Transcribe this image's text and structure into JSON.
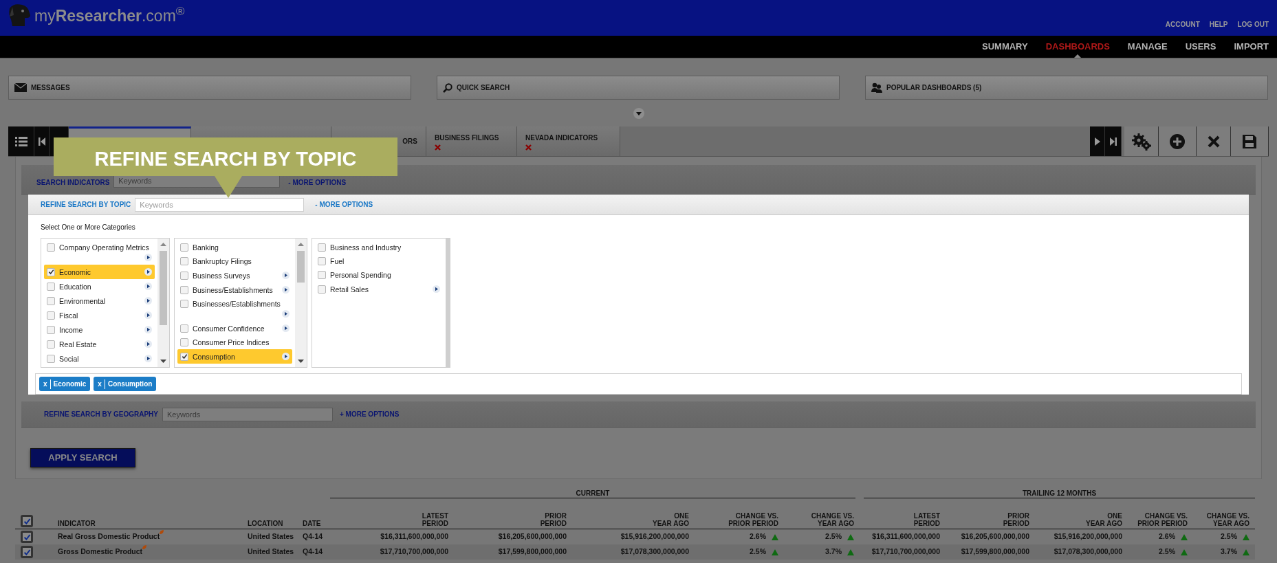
{
  "header": {
    "logo": "my**Researcher**.com$^{®}$",
    "account_links": [
      "ACCOUNT",
      "HELP",
      "LOG OUT"
    ]
  },
  "nav": [
    {
      "label": "SUMMARY",
      "selected": false
    },
    {
      "label": "DASHBOARDS",
      "selected": true
    },
    {
      "label": "MANAGE",
      "selected": false
    },
    {
      "label": "USERS",
      "selected": false
    },
    {
      "label": "IMPORT",
      "selected": false
    }
  ],
  "quick_panels": [
    {
      "label": "MESSAGES",
      "kind": "messages"
    },
    {
      "label": "QUICK SEARCH",
      "kind": "search"
    },
    {
      "label": "POPULAR DASHBOARDS (5)",
      "kind": "people"
    }
  ],
  "tabs": [
    {
      "selected": true
    },
    {
      "selected": false
    },
    {
      "label": "ORS",
      "selected": false
    },
    {
      "label": "BUSINESS FILINGS",
      "closable": true,
      "selected": false
    },
    {
      "label": "NEVADA INDICATORS",
      "closable": true,
      "selected": false
    }
  ],
  "callout": {
    "text": "REFINE SEARCH BY TOPIC"
  },
  "search_indicators": {
    "label": "SEARCH INDICATORS",
    "placeholder": "Keywords",
    "more_options": "- MORE OPTIONS"
  },
  "topic": {
    "label": "REFINE SEARCH BY TOPIC",
    "placeholder": "Keywords",
    "more_options": "- MORE OPTIONS",
    "instructions": "Select One or More Categories",
    "columns": [
      [
        {
          "label": "Company Operating Metrics",
          "checked": false,
          "selected": false,
          "expandable": true
        },
        {
          "label": "Economic",
          "checked": true,
          "selected": true,
          "expandable": true
        },
        {
          "label": "Education",
          "checked": false,
          "selected": false,
          "expandable": true
        },
        {
          "label": "Environmental",
          "checked": false,
          "selected": false,
          "expandable": true
        },
        {
          "label": "Fiscal",
          "checked": false,
          "selected": false,
          "expandable": true
        },
        {
          "label": "Income",
          "checked": false,
          "selected": false,
          "expandable": true
        },
        {
          "label": "Real Estate",
          "checked": false,
          "selected": false,
          "expandable": true
        },
        {
          "label": "Social",
          "checked": false,
          "selected": false,
          "expandable": true
        }
      ],
      [
        {
          "label": "Banking",
          "checked": false,
          "selected": false,
          "expandable": false
        },
        {
          "label": "Bankruptcy Filings",
          "checked": false,
          "selected": false,
          "expandable": false
        },
        {
          "label": "Business Surveys",
          "checked": false,
          "selected": false,
          "expandable": true
        },
        {
          "label": "Business/Establishments",
          "checked": false,
          "selected": false,
          "expandable": true
        },
        {
          "label": "Businesses/Establishments",
          "checked": false,
          "selected": false,
          "expandable": true
        },
        {
          "label": "Consumer Confidence",
          "checked": false,
          "selected": false,
          "expandable": true
        },
        {
          "label": "Consumer Price Indices",
          "checked": false,
          "selected": false,
          "expandable": false
        },
        {
          "label": "Consumption",
          "checked": true,
          "selected": true,
          "expandable": true
        }
      ],
      [
        {
          "label": "Business and Industry",
          "checked": false,
          "selected": false,
          "expandable": false
        },
        {
          "label": "Fuel",
          "checked": false,
          "selected": false,
          "expandable": false
        },
        {
          "label": "Personal Spending",
          "checked": false,
          "selected": false,
          "expandable": false
        },
        {
          "label": "Retail Sales",
          "checked": false,
          "selected": false,
          "expandable": true
        }
      ]
    ],
    "tags": [
      {
        "remove": "x",
        "label": "Economic"
      },
      {
        "remove": "x",
        "label": "Consumption"
      }
    ]
  },
  "geography": {
    "label": "REFINE SEARCH BY GEOGRAPHY",
    "placeholder": "Keywords",
    "more_options": "+ MORE OPTIONS"
  },
  "apply_button": "APPLY SEARCH",
  "table": {
    "groups": [
      "CURRENT",
      "TRAILING 12 MONTHS"
    ],
    "all_checked": true,
    "columns": [
      "INDICATOR",
      "LOCATION",
      "DATE",
      "LATEST\nPERIOD",
      "PRIOR\nPERIOD",
      "ONE\nYEAR AGO",
      "CHANGE VS.\nPRIOR PERIOD",
      "CHANGE VS.\nYEAR AGO",
      "LATEST\nPERIOD",
      "PRIOR\nPERIOD",
      "ONE\nYEAR AGO",
      "CHANGE VS.\nPRIOR PERIOD",
      "CHANGE VS.\nYEAR AGO"
    ],
    "rows": [
      {
        "checked": true,
        "indicator": "Real Gross Domestic Product",
        "location": "United States",
        "date": "Q4-14",
        "values": [
          {
            "text": "$16,311,600,000,000"
          },
          {
            "text": "$16,205,600,000,000"
          },
          {
            "text": "$15,916,200,000,000"
          },
          {
            "text": "2.6%",
            "rising": true
          },
          {
            "text": "2.5%",
            "rising": true
          },
          {
            "text": "$16,311,600,000,000"
          },
          {
            "text": "$16,205,600,000,000"
          },
          {
            "text": "$15,916,200,000,000"
          },
          {
            "text": "2.6%",
            "rising": true
          },
          {
            "text": "2.5%",
            "rising": true
          }
        ]
      },
      {
        "checked": true,
        "indicator": "Gross Domestic Product",
        "location": "United States",
        "date": "Q4-14",
        "values": [
          {
            "text": "$17,710,700,000,000"
          },
          {
            "text": "$17,599,800,000,000"
          },
          {
            "text": "$17,078,300,000,000"
          },
          {
            "text": "2.5%",
            "rising": true
          },
          {
            "text": "3.7%",
            "rising": true
          },
          {
            "text": "$17,710,700,000,000"
          },
          {
            "text": "$17,599,800,000,000"
          },
          {
            "text": "$17,078,300,000,000"
          },
          {
            "text": "2.5%",
            "rising": true
          },
          {
            "text": "3.7%",
            "rising": true
          }
        ]
      }
    ]
  }
}
